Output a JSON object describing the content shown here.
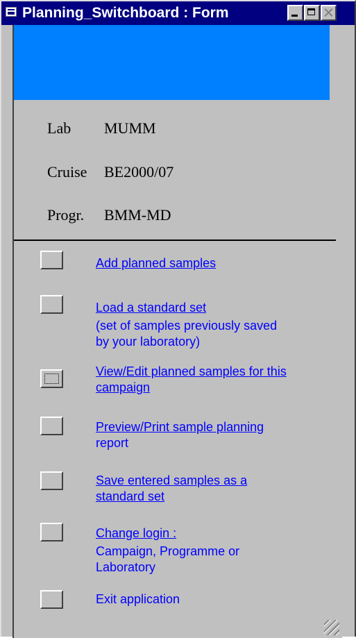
{
  "window": {
    "title": "Planning_Switchboard : Form"
  },
  "info": {
    "lab_label": "Lab",
    "lab_value": "MUMM",
    "cruise_label": "Cruise",
    "cruise_value": "BE2000/07",
    "progr_label": "Progr.",
    "progr_value": "BMM-MD"
  },
  "menu": {
    "items": [
      {
        "line1": "Add planned samples"
      },
      {
        "line1": "Load a standard set",
        "note1": " (set of samples previously saved",
        "note2": "by your laboratory)"
      },
      {
        "line1": "View/Edit planned samples for this",
        "line2": "campaign"
      },
      {
        "line1": "Preview/Print sample planning ",
        "note1": "report"
      },
      {
        "line1": "Save entered samples as a",
        "line2": "standard set"
      },
      {
        "line1": "Change login :",
        "note1": "Campaign, Programme or",
        "note2": "Laboratory"
      },
      {
        "note1": "Exit application"
      }
    ]
  },
  "colors": {
    "title_bar": "#000080",
    "header_band": "#0080ff",
    "form_background": "#c0c0c0",
    "link": "#0000ff"
  }
}
